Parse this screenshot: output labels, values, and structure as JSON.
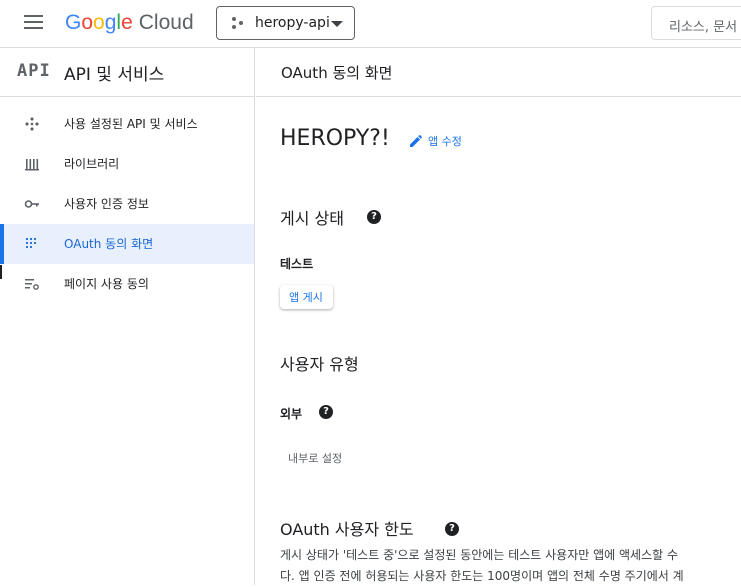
{
  "header": {
    "logo_parts": [
      "G",
      "o",
      "o",
      "g",
      "l",
      "e"
    ],
    "logo_suffix": "Cloud",
    "project_name": "heropy-api",
    "search_placeholder": "리소스, 문서"
  },
  "sidebar": {
    "logo_text": "API",
    "title": "API 및 서비스",
    "items": [
      {
        "label": "사용 설정된 API 및 서비스",
        "icon": "enabled-apis-icon"
      },
      {
        "label": "라이브러리",
        "icon": "library-icon"
      },
      {
        "label": "사용자 인증 정보",
        "icon": "key-icon"
      },
      {
        "label": "OAuth 동의 화면",
        "icon": "oauth-consent-icon",
        "active": true
      },
      {
        "label": "페이지 사용 동의",
        "icon": "page-agreement-icon"
      }
    ]
  },
  "main": {
    "page_title": "OAuth 동의 화면",
    "app_name": "HEROPY?!",
    "edit_app_label": "앱 수정",
    "publish_status": {
      "heading": "게시 상태",
      "status": "테스트",
      "publish_button": "앱 게시"
    },
    "user_type": {
      "heading": "사용자 유형",
      "value": "외부",
      "internal_button": "내부로 설정"
    },
    "user_cap": {
      "heading": "OAuth 사용자 한도",
      "line1": "게시 상태가 '테스트 중'으로 설정된 동안에는 테스트 사용자만 앱에 액세스할 수",
      "line2": "다. 앱 인증 전에 허용되는 사용자 한도는 100명이며 앱의 전체 수명 주기에서 계"
    }
  },
  "colors": {
    "accent": "#1a73e8",
    "active_bg": "#e8f0fe"
  }
}
